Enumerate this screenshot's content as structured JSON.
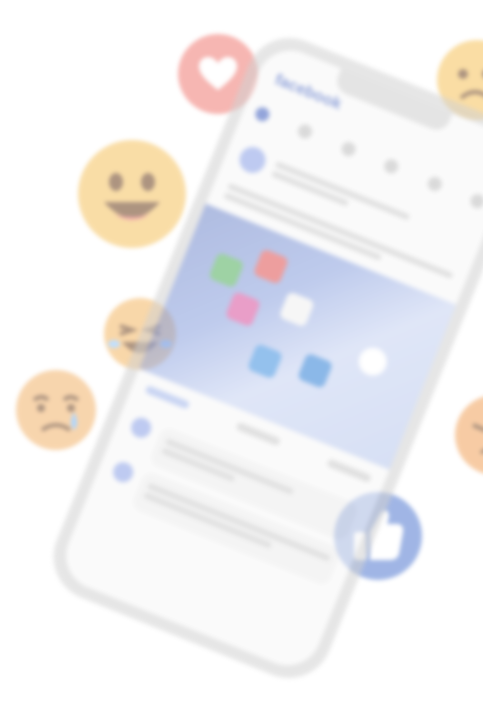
{
  "scene": {
    "app_name_on_screen": "facebook"
  },
  "colors": {
    "facebook_blue": "#3b5bbd",
    "heart_red": "#f07b74",
    "emoji_yellow": "#f5c25f",
    "like_blue": "#6e8fd8"
  },
  "icons": [
    "heart-reaction-icon",
    "laughing-emoji-icon",
    "crying-emoji-icon",
    "sad-emoji-icon",
    "angry-emoji-icon",
    "like-thumbs-up-icon"
  ]
}
